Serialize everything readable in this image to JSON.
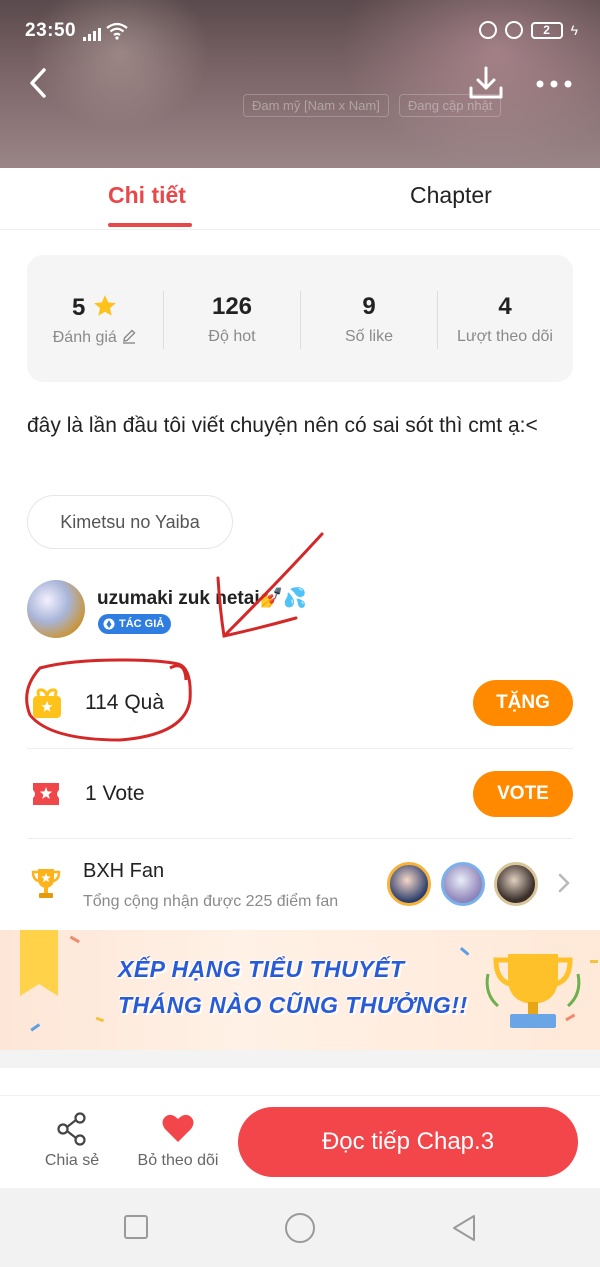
{
  "status_bar": {
    "time": "23:50",
    "battery": "2"
  },
  "header": {
    "genres": [
      "Đam mỹ [Nam x Nam]",
      "Đang cập nhật"
    ]
  },
  "tabs": [
    {
      "label": "Chi tiết",
      "active": true
    },
    {
      "label": "Chapter",
      "active": false
    }
  ],
  "stats": [
    {
      "value": "5",
      "label": "Đánh giá"
    },
    {
      "value": "126",
      "label": "Độ hot"
    },
    {
      "value": "9",
      "label": "Số like"
    },
    {
      "value": "4",
      "label": "Lượt theo dõi"
    }
  ],
  "description": "đây là lần đầu tôi viết chuyện nên có sai sót thì cmt ạ:<",
  "tag": "Kimetsu no Yaiba",
  "author": {
    "name": "uzumaki zuk netai💅💦",
    "badge": "TÁC GIẢ"
  },
  "gifts": {
    "label": "114 Quà",
    "button": "TẶNG"
  },
  "votes": {
    "label": "1 Vote",
    "button": "VOTE"
  },
  "fan_ranking": {
    "title": "BXH Fan",
    "subtitle": "Tổng cộng nhận được 225 điểm fan"
  },
  "banner": {
    "line1": "XẾP HẠNG TIỂU THUYẾT",
    "line2": "THÁNG NÀO CŨNG THƯỞNG!!"
  },
  "bottom_bar": {
    "share": "Chia sẻ",
    "unfollow": "Bỏ theo dõi",
    "read": "Đọc tiếp Chap.3"
  },
  "colors": {
    "accent": "#e8484a",
    "orange": "#ff8a00",
    "read_button": "#f2464b",
    "badge_blue": "#2f7de1"
  }
}
